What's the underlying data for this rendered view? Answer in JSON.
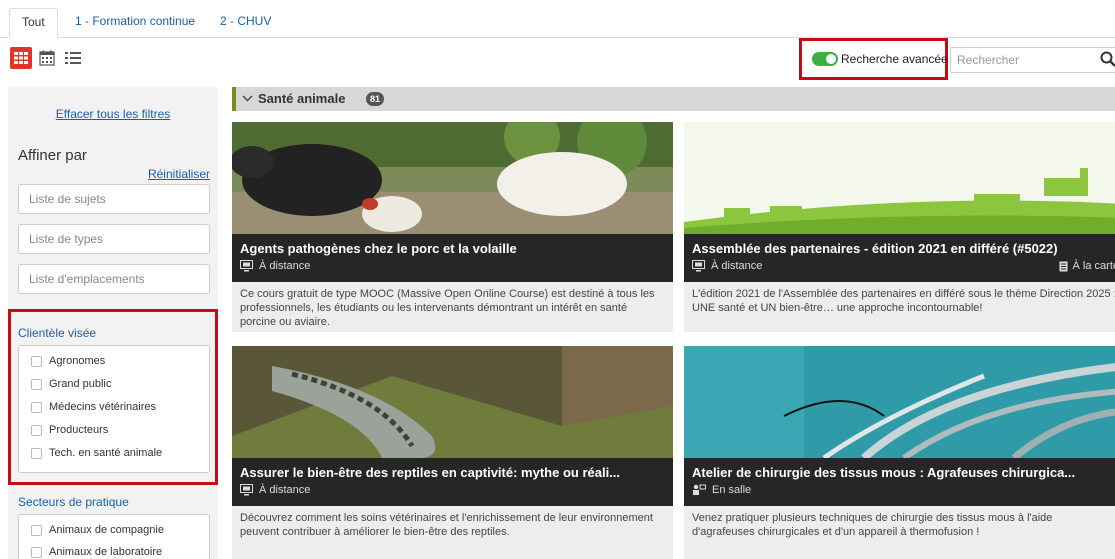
{
  "tabs": [
    {
      "label": "Tout",
      "active": true
    },
    {
      "label": "1 - Formation continue",
      "active": false
    },
    {
      "label": "2 - CHUV",
      "active": false
    }
  ],
  "toolbar": {
    "advanced_search_label": "Recherche avancée",
    "search_placeholder": "Rechercher",
    "accent_color": "#e0342b",
    "toggle_color": "#3cb043"
  },
  "sidebar": {
    "clear_filters": "Effacer tous les filtres",
    "refine_title": "Affiner par",
    "reset": "Réinitialiser",
    "filter_placeholders": [
      "Liste de sujets",
      "Liste de types",
      "Liste d'emplacements"
    ],
    "client_section": {
      "title": "Clientèle visée",
      "options": [
        "Agronomes",
        "Grand public",
        "Médecins vétérinaires",
        "Producteurs",
        "Tech. en santé animale"
      ]
    },
    "sector_section": {
      "title": "Secteurs de pratique",
      "options": [
        "Animaux de compagnie",
        "Animaux de laboratoire"
      ]
    }
  },
  "category": {
    "label": "Santé animale",
    "count": "81"
  },
  "cards": [
    {
      "title": "Agents pathogènes chez le porc et la volaille",
      "mode": "À distance",
      "mode_icon": "monitor-icon",
      "extra": "",
      "description": "Ce cours gratuit de type MOOC (Massive Open Online Course) est destiné à tous les professionnels, les étudiants ou les intervenants démontrant un intérêt en santé porcine ou aviaire."
    },
    {
      "title": "Assemblée des partenaires - édition 2021 en différé (#5022)",
      "mode": "À distance",
      "mode_icon": "monitor-icon",
      "extra": "À la carte",
      "description": "L'édition 2021 de l'Assemblée des partenaires en différé sous le thème Direction 2025 : UNE santé et UN bien-être… une approche incontournable!"
    },
    {
      "title": "Assurer le bien-être des reptiles en captivité: mythe ou réali...",
      "mode": "À distance",
      "mode_icon": "monitor-icon",
      "extra": "",
      "description": "Découvrez comment les soins vétérinaires et l'enrichissement de leur environnement peuvent contribuer à améliorer le bien-être des reptiles."
    },
    {
      "title": "Atelier de chirurgie des tissus mous : Agrafeuses chirurgica...",
      "mode": "En salle",
      "mode_icon": "classroom-icon",
      "extra": "",
      "description": "Venez pratiquer plusieurs techniques de chirurgie des tissus mous à l'aide d'agrafeuses chirurgicales et d'un appareil à thermofusion !"
    }
  ]
}
